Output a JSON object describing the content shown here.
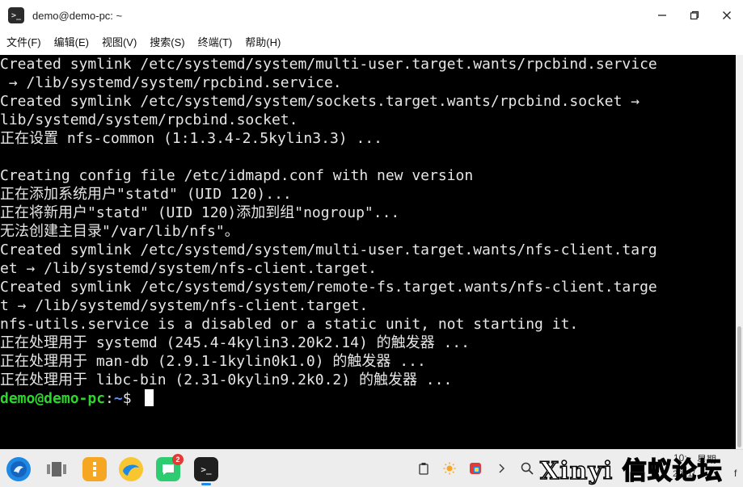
{
  "window": {
    "title": "demo@demo-pc: ~",
    "app_icon_glyph": ">_",
    "icons": [
      "terminal-app-icon",
      "minimize-icon",
      "maximize-icon",
      "close-icon"
    ]
  },
  "menu": {
    "items": [
      "文件(F)",
      "编辑(E)",
      "视图(V)",
      "搜索(S)",
      "终端(T)",
      "帮助(H)"
    ]
  },
  "terminal": {
    "lines": [
      "Created symlink /etc/systemd/system/multi-user.target.wants/rpcbind.service",
      " → /lib/systemd/system/rpcbind.service.",
      "Created symlink /etc/systemd/system/sockets.target.wants/rpcbind.socket →",
      "lib/systemd/system/rpcbind.socket.",
      "正在设置 nfs-common (1:1.3.4-2.5kylin3.3) ...",
      "",
      "Creating config file /etc/idmapd.conf with new version",
      "正在添加系统用户\"statd\" (UID 120)...",
      "正在将新用户\"statd\" (UID 120)添加到组\"nogroup\"...",
      "无法创建主目录\"/var/lib/nfs\"。",
      "Created symlink /etc/systemd/system/multi-user.target.wants/nfs-client.targ",
      "et → /lib/systemd/system/nfs-client.target.",
      "Created symlink /etc/systemd/system/remote-fs.target.wants/nfs-client.targe",
      "t → /lib/systemd/system/nfs-client.target.",
      "nfs-utils.service is a disabled or a static unit, not starting it.",
      "正在处理用于 systemd (245.4-4kylin3.20k2.14) 的触发器 ...",
      "正在处理用于 man-db (2.9.1-1kylin0k1.0) 的触发器 ...",
      "正在处理用于 libc-bin (2.31-0kylin9.2k0.2) 的触发器 ..."
    ],
    "prompt": {
      "user_host": "demo@demo-pc",
      "separator": ":",
      "path": "~",
      "symbol": "$ "
    }
  },
  "taskbar": {
    "apps": [
      {
        "name": "start-menu-icon"
      },
      {
        "name": "multitask-view-icon"
      },
      {
        "name": "file-manager-icon"
      },
      {
        "name": "browser-icon"
      },
      {
        "name": "chat-app-icon",
        "badge": "2"
      },
      {
        "name": "terminal-taskbar-icon",
        "active": true
      }
    ],
    "tray": {
      "icons": [
        "clipboard-icon",
        "brightness-icon",
        "color-app-icon",
        "expand-tray-icon",
        "search-icon"
      ],
      "clock": "10:",
      "weekday": "星期",
      "date": "2021/",
      "partial_text": "f"
    },
    "watermark": "Xinyi 信蚁论坛"
  },
  "colors": {
    "terminal_bg": "#000000",
    "terminal_fg": "#e6e6e6",
    "prompt_user": "#2fd52f",
    "prompt_path": "#5a8fff",
    "badge": "#e53935",
    "accent": "#1e88e5"
  }
}
